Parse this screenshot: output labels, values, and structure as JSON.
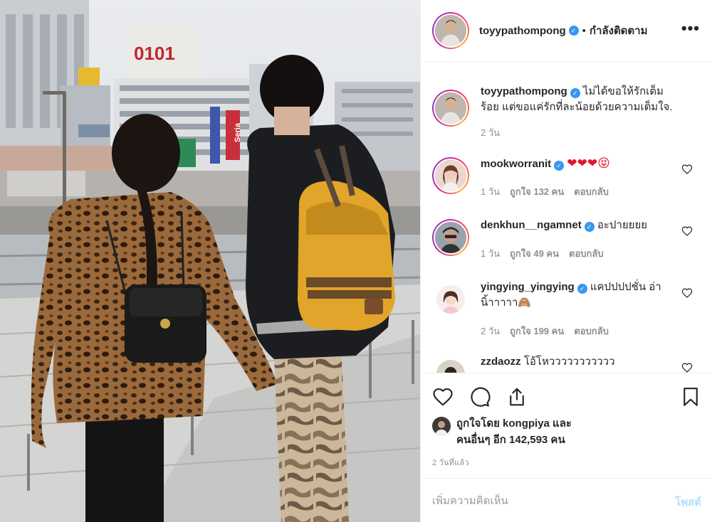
{
  "header": {
    "username": "toyypathompong",
    "separator": "•",
    "follow_status": "กำลังติดตาม",
    "more_icon": "more-horizontal-icon"
  },
  "caption": {
    "username": "toyypathompong",
    "text": "ไม่ได้ขอให้รักเต็มร้อย แต่ขอแค่รักที่ละน้อยด้วยความเต็มใจ.",
    "time": "2 วัน"
  },
  "comments": [
    {
      "username": "mookworranit",
      "verified": true,
      "text": "❤❤❤😝",
      "time": "1 วัน",
      "likes": "ถูกใจ 132 คน",
      "reply": "ตอบกลับ"
    },
    {
      "username": "denkhun__ngamnet",
      "verified": true,
      "text": "อะปายยยย",
      "time": "1 วัน",
      "likes": "ถูกใจ 49 คน",
      "reply": "ตอบกลับ"
    },
    {
      "username": "yingying_yingying",
      "verified": true,
      "text": "แคปปปปชั่น อ่านิ้าาาาา🙈",
      "time": "2 วัน",
      "likes": "ถูกใจ 199 คน",
      "reply": "ตอบกลับ"
    },
    {
      "username": "zzdaozz",
      "verified": false,
      "text": "โอ้โหววววววววววว",
      "time": "",
      "likes": "",
      "reply": ""
    }
  ],
  "actions": {
    "like_icon": "heart-icon",
    "comment_icon": "comment-icon",
    "share_icon": "share-icon",
    "save_icon": "bookmark-icon"
  },
  "likes": {
    "line1": "ถูกใจโดย kongpiya และ",
    "line2": "คนอื่นๆ อีก 142,593 คน"
  },
  "posted_time": "2 วันที่แล้ว",
  "add_comment": {
    "placeholder": "เพิ่มความคิดเห็น",
    "post_label": "โพสต์"
  },
  "photo": {
    "building_sign": "0101",
    "shop_sign": "Seria"
  },
  "colors": {
    "verified": "#3897f0",
    "meta_text": "#8e8e8e",
    "post_button_disabled": "#b2dffc",
    "story_ring": "#d6249f"
  }
}
